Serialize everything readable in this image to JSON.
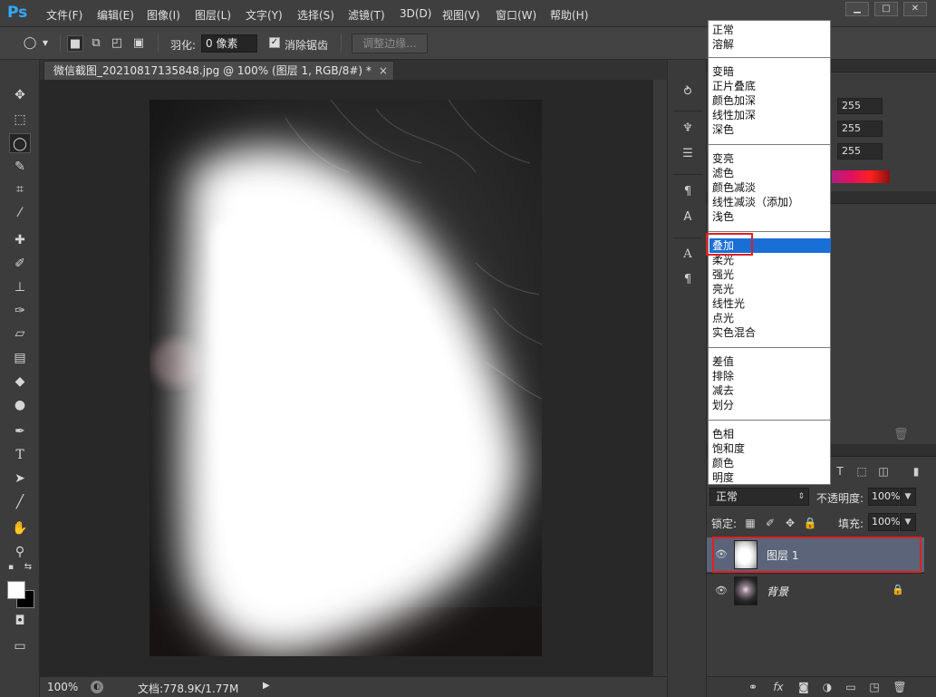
{
  "app": {
    "logo": "Ps"
  },
  "menu": [
    {
      "label": "文件(F)"
    },
    {
      "label": "编辑(E)"
    },
    {
      "label": "图像(I)"
    },
    {
      "label": "图层(L)"
    },
    {
      "label": "文字(Y)"
    },
    {
      "label": "选择(S)"
    },
    {
      "label": "滤镜(T)"
    },
    {
      "label": "3D(D)"
    },
    {
      "label": "视图(V)"
    },
    {
      "label": "窗口(W)"
    },
    {
      "label": "帮助(H)"
    }
  ],
  "options": {
    "feather_label": "羽化:",
    "feather_value": "0 像素",
    "antialias_label": "消除锯齿",
    "refine_label": "调整边缘..."
  },
  "document": {
    "tab_title": "微信截图_20210817135848.jpg @ 100% (图层 1, RGB/8#) *",
    "close": "×"
  },
  "status": {
    "zoom": "100%",
    "doc_info": "文档:778.9K/1.77M"
  },
  "color_panel": {
    "r": "255",
    "g": "255",
    "b": "255"
  },
  "layers_panel": {
    "blend_mode": "正常",
    "opacity_label": "不透明度:",
    "opacity_value": "100%",
    "lock_label": "锁定:",
    "fill_label": "填充:",
    "fill_value": "100%",
    "layers": [
      {
        "name": "图层 1",
        "selected": true
      },
      {
        "name": "背景",
        "selected": false,
        "locked": true
      }
    ]
  },
  "blend_dropdown": {
    "groups": [
      [
        "正常",
        "溶解"
      ],
      [
        "变暗",
        "正片叠底",
        "颜色加深",
        "线性加深",
        "深色"
      ],
      [
        "变亮",
        "滤色",
        "颜色减淡",
        "线性减淡（添加）",
        "浅色"
      ],
      [
        "叠加",
        "柔光",
        "强光",
        "亮光",
        "线性光",
        "点光",
        "实色混合"
      ],
      [
        "差值",
        "排除",
        "减去",
        "划分"
      ],
      [
        "色相",
        "饱和度",
        "颜色",
        "明度"
      ]
    ],
    "selected": "叠加"
  },
  "colors": {
    "selection_blue": "#1a6fd6",
    "highlight_red": "#e02020",
    "layer_selected": "#5b6478"
  }
}
